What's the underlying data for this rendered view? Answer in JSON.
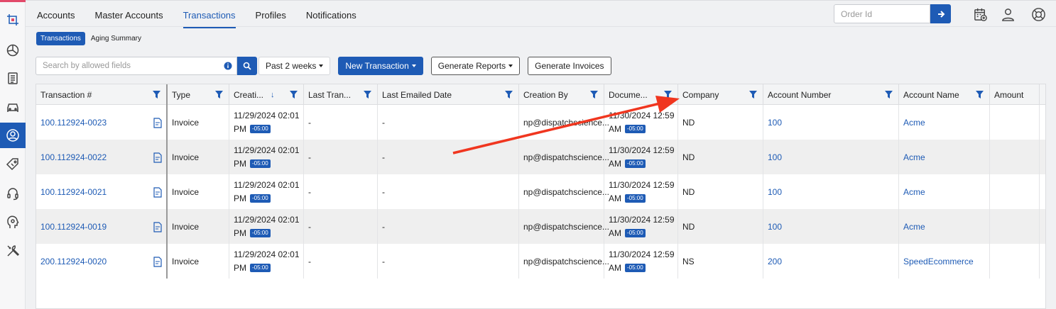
{
  "colors": {
    "accent": "#1e5bb5",
    "annotation_arrow": "#f0361f"
  },
  "sidebar": {
    "icons": [
      "crop-logo-icon",
      "pie-chart-icon",
      "clipboard-icon",
      "car-icon",
      "user-circle-icon",
      "tag-icon",
      "headset-icon",
      "gear-head-icon",
      "tools-icon"
    ],
    "active": "user-circle-icon"
  },
  "nav": {
    "tabs": [
      "Accounts",
      "Master Accounts",
      "Transactions",
      "Profiles",
      "Notifications"
    ],
    "active": "Transactions"
  },
  "header": {
    "order_placeholder": "Order Id",
    "icons": [
      "calendar-add-icon",
      "user-icon",
      "lifebuoy-icon"
    ]
  },
  "subtabs": {
    "items": [
      "Transactions",
      "Aging Summary"
    ],
    "active": "Transactions"
  },
  "toolbar": {
    "search_placeholder": "Search by allowed fields",
    "period": "Past 2 weeks",
    "new_transaction": "New Transaction",
    "generate_reports": "Generate Reports",
    "generate_invoices": "Generate Invoices"
  },
  "table": {
    "columns": [
      "Transaction #",
      "Type",
      "Creati...",
      "Last Tran...",
      "Last Emailed Date",
      "Creation By",
      "Docume...",
      "Company",
      "Account Number",
      "Account Name",
      "Amount"
    ],
    "rows": [
      {
        "transaction": "100.112924-0023",
        "type": "Invoice",
        "created_date": "11/29/2024 02:01",
        "created_ampm": "PM",
        "created_tz": "-05:00",
        "last_tran": "-",
        "last_emailed": "-",
        "created_by": "np@dispatchscience...",
        "doc_date": "11/30/2024 12:59",
        "doc_ampm": "AM",
        "doc_tz": "-05:00",
        "company": "ND",
        "account_number": "100",
        "account_name": "Acme",
        "amount": ""
      },
      {
        "transaction": "100.112924-0022",
        "type": "Invoice",
        "created_date": "11/29/2024 02:01",
        "created_ampm": "PM",
        "created_tz": "-05:00",
        "last_tran": "-",
        "last_emailed": "-",
        "created_by": "np@dispatchscience...",
        "doc_date": "11/30/2024 12:59",
        "doc_ampm": "AM",
        "doc_tz": "-05:00",
        "company": "ND",
        "account_number": "100",
        "account_name": "Acme",
        "amount": ""
      },
      {
        "transaction": "100.112924-0021",
        "type": "Invoice",
        "created_date": "11/29/2024 02:01",
        "created_ampm": "PM",
        "created_tz": "-05:00",
        "last_tran": "-",
        "last_emailed": "-",
        "created_by": "np@dispatchscience...",
        "doc_date": "11/30/2024 12:59",
        "doc_ampm": "AM",
        "doc_tz": "-05:00",
        "company": "ND",
        "account_number": "100",
        "account_name": "Acme",
        "amount": ""
      },
      {
        "transaction": "100.112924-0019",
        "type": "Invoice",
        "created_date": "11/29/2024 02:01",
        "created_ampm": "PM",
        "created_tz": "-05:00",
        "last_tran": "-",
        "last_emailed": "-",
        "created_by": "np@dispatchscience...",
        "doc_date": "11/30/2024 12:59",
        "doc_ampm": "AM",
        "doc_tz": "-05:00",
        "company": "ND",
        "account_number": "100",
        "account_name": "Acme",
        "amount": ""
      },
      {
        "transaction": "200.112924-0020",
        "type": "Invoice",
        "created_date": "11/29/2024 02:01",
        "created_ampm": "PM",
        "created_tz": "-05:00",
        "last_tran": "-",
        "last_emailed": "-",
        "created_by": "np@dispatchscience...",
        "doc_date": "11/30/2024 12:59",
        "doc_ampm": "AM",
        "doc_tz": "-05:00",
        "company": "NS",
        "account_number": "200",
        "account_name": "SpeedEcommerce",
        "amount": ""
      }
    ]
  }
}
